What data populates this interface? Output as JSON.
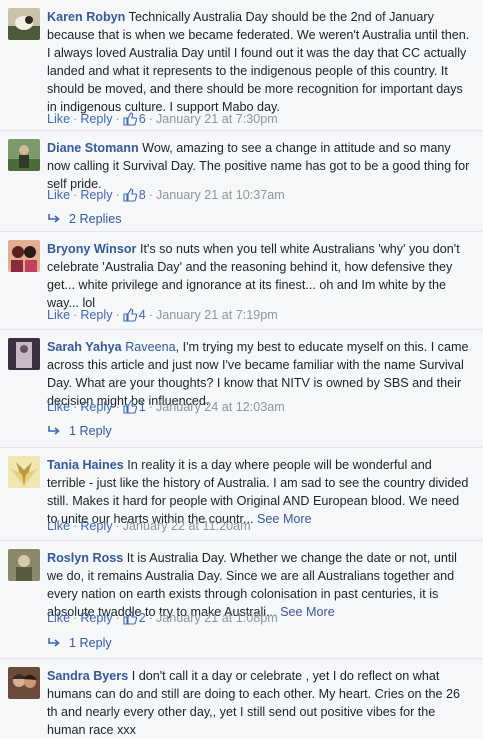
{
  "actions": {
    "like": "Like",
    "reply": "Reply",
    "sep": "·"
  },
  "comments": [
    {
      "author": "Karen Robyn",
      "text": "Technically Australia Day should be the 2nd of January because that is when we became federated. We weren't Australia until then. I always loved Australia Day until I found out it was the day that CC actually landed and what it represents to the indigenous people of this country. It should be moved, and there should be more recognition for important days in indigenous culture. I support Mabo day.",
      "likes": "6",
      "time": "January 21 at 7:30pm",
      "avatar_colors": [
        "#4a5a3a",
        "#c9c2a8"
      ]
    },
    {
      "author": "Diane Stomann",
      "text": "Wow, amazing to see a change in attitude and so many now calling it Survival Day. The positive name has got to be a good thing for self pride.",
      "likes": "8",
      "time": "January 21 at 10:37am",
      "replies": "2 Replies",
      "avatar_colors": [
        "#6f8b5a",
        "#2d3a2a"
      ]
    },
    {
      "author": "Bryony Winsor",
      "text": "It's so nuts when you tell white Australians 'why' you don't celebrate 'Australia Day' and the reasoning behind it, how defensive they get... white privilege and ignorance at its finest... oh and Im white by the way... lol",
      "likes": "4",
      "time": "January 21 at 7:19pm",
      "avatar_colors": [
        "#8a2a3a",
        "#e0b090"
      ]
    },
    {
      "author": "Sarah Yahya",
      "mention": "Raveena",
      "text": ", I'm trying my best to educate myself on this. I came across this article and just now I've became familiar with the name Survival Day. What are your thoughts? I know that NITV is owned by SBS and their decision might be influenced.",
      "likes": "1",
      "time": "January 24 at 12:03am",
      "replies": "1 Reply",
      "avatar_colors": [
        "#3a3040",
        "#c9b8c8"
      ]
    },
    {
      "author": "Tania Haines",
      "text": "In reality it is a day where people will be wonderful and terrible - just like the history of Australia. I am sad to see the country divided still. Makes it hard for people with Original AND European blood. We need to unite our hearts within the countr...",
      "see_more": "See More",
      "time": "January 22 at 11:20am",
      "avatar_colors": [
        "#e8d080",
        "#b89a40"
      ]
    },
    {
      "author": "Roslyn Ross",
      "text": "It is Australia Day. Whether we change the date or not, until we do, it remains Australia Day. Since we are all Australians together and every nation on earth exists through colonisation in past centuries, it is absolute twaddle to try to make Australi...",
      "see_more": "See More",
      "likes": "2",
      "time": "January 21 at 1:08pm",
      "replies": "1 Reply",
      "avatar_colors": [
        "#5a5a40",
        "#d8c8a8"
      ]
    },
    {
      "author": "Sandra Byers",
      "text": "I don't call it a day or celebrate , yet I do reflect on what humans can do and still are doing to each other. My heart. Cries on the 26 th and nearly every other day,, yet I still send out positive vibes for the human race xxx",
      "avatar_colors": [
        "#3a2a20",
        "#d8b098"
      ]
    }
  ]
}
